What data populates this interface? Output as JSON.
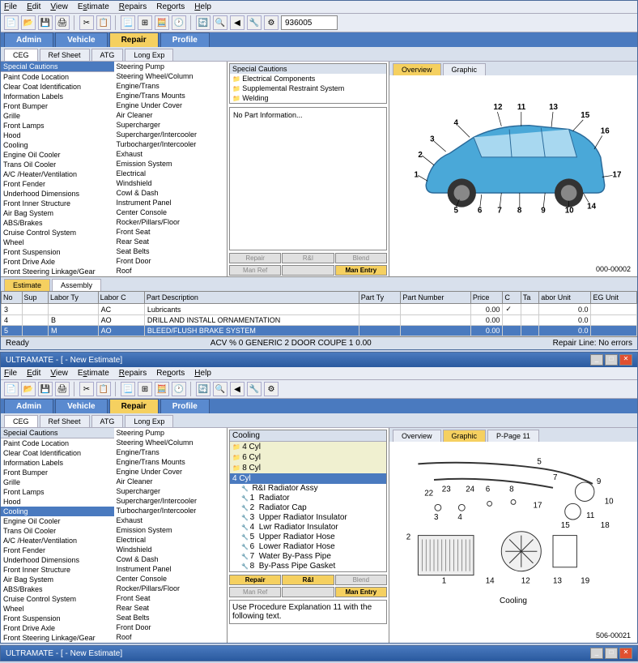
{
  "window1": {
    "title": "ULTRAMATE - [ - New Estimate]",
    "menu": [
      "File",
      "Edit",
      "View",
      "Estimate",
      "Repairs",
      "Reports",
      "Help"
    ],
    "searchVal": "936005",
    "maintabs": [
      "Admin",
      "Vehicle",
      "Repair",
      "Profile"
    ],
    "mainActive": 2,
    "subtabs": [
      "CEG",
      "Ref Sheet",
      "ATG",
      "Long Exp"
    ],
    "subActive": 0,
    "col1hdr": "Special Cautions",
    "col1": [
      "Paint Code Location",
      "Clear Coat Identification",
      "Information Labels",
      "Front Bumper",
      "Grille",
      "Front Lamps",
      "Hood",
      "Cooling",
      "Engine Oil Cooler",
      "Trans Oil Cooler",
      "A/C /Heater/Ventilation",
      "Front Fender",
      "Underhood Dimensions",
      "Front Inner Structure",
      "Air Bag System",
      "ABS/Brakes",
      "Cruise Control System",
      "Wheel",
      "Front Suspension",
      "Front Drive Axle",
      "Front Steering Linkage/Gear"
    ],
    "col2": [
      "Steering Pump",
      "Steering Wheel/Column",
      "Engine/Trans",
      "Engine/Trans Mounts",
      "Engine Under Cover",
      "Air Cleaner",
      "Supercharger",
      "Supercharger/Intercooler",
      "Turbocharger/Intercooler",
      "Exhaust",
      "Emission System",
      "Electrical",
      "Windshield",
      "Cowl & Dash",
      "Instrument Panel",
      "Center Console",
      "Rocker/Pillars/Floor",
      "Front Seat",
      "Rear Seat",
      "Seat Belts",
      "Front Door",
      "Roof"
    ],
    "cautionsHdr": "Special Cautions",
    "cautions": [
      "Electrical Components",
      "Supplemental Restraint System",
      "Welding"
    ],
    "noPart": "No Part Information...",
    "btns1": [
      "Repair",
      "R&I",
      "Blend"
    ],
    "btns2": [
      "Man Ref",
      "",
      "Man Entry"
    ],
    "rtabs": [
      "Overview",
      "Graphic"
    ],
    "rActive": 0,
    "diagId": "000-00002",
    "esttabs": [
      "Estimate",
      "Assembly"
    ],
    "estActive": 0,
    "gridH": [
      "No",
      "Sup",
      "Labor Ty",
      "Labor C",
      "Part Description",
      "Part Ty",
      "Part Number",
      "Price",
      "C",
      "Ta",
      "abor Unit",
      "EG Unit"
    ],
    "rows": [
      {
        "no": "3",
        "sup": "",
        "lt": "",
        "lc": "AC",
        "desc": "Lubricants",
        "pt": "",
        "pn": "",
        "price": "0.00",
        "c": "✓",
        "ta": "",
        "lu": "0.0",
        "eg": ""
      },
      {
        "no": "4",
        "sup": "",
        "lt": "B",
        "lc": "AO",
        "desc": "DRILL AND INSTALL ORNAMENTATION",
        "pt": "",
        "pn": "",
        "price": "0.00",
        "c": "",
        "ta": "",
        "lu": "0.0",
        "eg": ""
      },
      {
        "no": "5",
        "sup": "",
        "lt": "M",
        "lc": "AO",
        "desc": "BLEED/FLUSH BRAKE SYSTEM",
        "pt": "",
        "pn": "",
        "price": "0.00",
        "c": "",
        "ta": "",
        "lu": "0.0",
        "eg": ""
      }
    ],
    "status": {
      "left": "Ready",
      "mid": "ACV % 0    GENERIC 2 DOOR COUPE 1       0.00",
      "right": "Repair Line: No errors"
    }
  },
  "window2": {
    "title": "ULTRAMATE - [ - New Estimate]",
    "col1sel": 7,
    "partHdr": "Cooling",
    "partCats": [
      "4 Cyl",
      "6 Cyl",
      "8 Cyl"
    ],
    "selCat": "4 Cyl",
    "parts": [
      {
        "n": "",
        "d": "R&I Radiator Assy"
      },
      {
        "n": "1",
        "d": "Radiator"
      },
      {
        "n": "2",
        "d": "Radiator Cap"
      },
      {
        "n": "3",
        "d": "Upper Radiator Insulator"
      },
      {
        "n": "4",
        "d": "Lwr Radiator Insulator"
      },
      {
        "n": "5",
        "d": "Upper Radiator Hose"
      },
      {
        "n": "6",
        "d": "Lower Radiator Hose"
      },
      {
        "n": "7",
        "d": "Water By-Pass Pipe"
      },
      {
        "n": "8",
        "d": "By-Pass Pipe Gasket"
      }
    ],
    "btns1": [
      "Repair",
      "R&I",
      "Blend"
    ],
    "btns2": [
      "Man Ref",
      "",
      "Man Entry"
    ],
    "procText": "Use Procedure Explanation 11 with the following text.",
    "rtabs": [
      "Overview",
      "Graphic",
      "P-Page 11"
    ],
    "rActive": 1,
    "diagId": "506-00021",
    "diagTitle": "Cooling"
  }
}
